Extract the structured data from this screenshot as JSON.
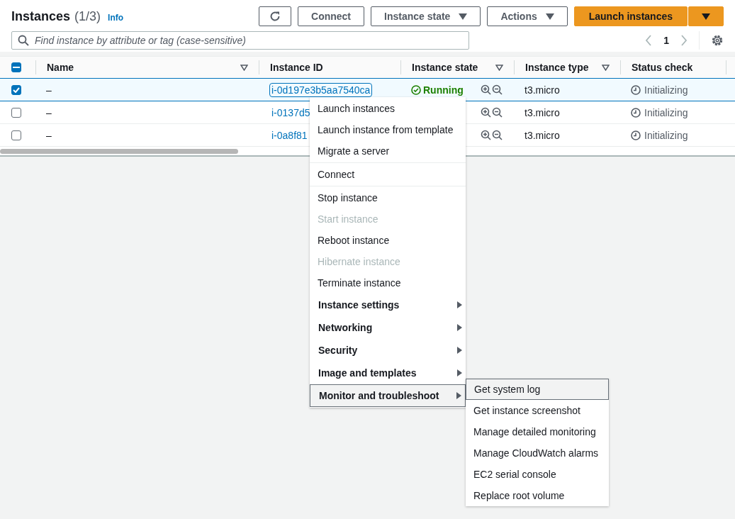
{
  "header": {
    "title": "Instances",
    "count": "(1/3)",
    "info": "Info"
  },
  "toolbar": {
    "buttons": [
      {
        "kind": "refresh"
      },
      {
        "kind": "plain",
        "label": "Connect"
      },
      {
        "kind": "dropdown",
        "label": "Instance state"
      },
      {
        "kind": "dropdown",
        "label": "Actions"
      },
      {
        "kind": "primary",
        "label": "Launch instances"
      }
    ]
  },
  "search": {
    "placeholder": "Find instance by attribute or tag (case-sensitive)"
  },
  "pagination": {
    "page": "1"
  },
  "table": {
    "select_all_partial": true,
    "columns": [
      {
        "label": "Name",
        "filter": true
      },
      {
        "label": "Instance ID",
        "filter": false
      },
      {
        "label": "Instance state",
        "filter": true
      },
      {
        "label": "Instance type",
        "filter": true
      },
      {
        "label": "Status check",
        "filter": false
      }
    ],
    "rows": [
      {
        "selected": true,
        "name": "–",
        "instance_id": "i-0d197e3b5aa7540ca",
        "state": "Running",
        "type": "t3.micro",
        "status": "Initializing"
      },
      {
        "selected": false,
        "name": "–",
        "instance_id": "i-0137d5",
        "type": "t3.micro",
        "status": "Initializing"
      },
      {
        "selected": false,
        "name": "–",
        "instance_id": "i-0a8f81",
        "type": "t3.micro",
        "status": "Initializing"
      }
    ]
  },
  "menu": {
    "sections": [
      [
        {
          "kind": "action",
          "label": "Launch instances",
          "disabled": false,
          "selected": false
        },
        {
          "kind": "action",
          "label": "Launch instance from template",
          "disabled": false,
          "selected": false
        },
        {
          "kind": "action",
          "label": "Migrate a server",
          "disabled": false,
          "selected": false
        }
      ],
      [
        {
          "kind": "action",
          "label": "Connect",
          "disabled": false,
          "selected": false
        }
      ],
      [
        {
          "kind": "action",
          "label": "Stop instance",
          "disabled": false,
          "selected": false
        },
        {
          "kind": "action",
          "label": "Start instance",
          "disabled": true,
          "selected": false
        },
        {
          "kind": "action",
          "label": "Reboot instance",
          "disabled": false,
          "selected": false
        },
        {
          "kind": "action",
          "label": "Hibernate instance",
          "disabled": true,
          "selected": false
        },
        {
          "kind": "action",
          "label": "Terminate instance",
          "disabled": false,
          "selected": false
        },
        {
          "kind": "submenu",
          "label": "Instance settings",
          "disabled": false,
          "selected": false
        },
        {
          "kind": "submenu",
          "label": "Networking",
          "disabled": false,
          "selected": false
        },
        {
          "kind": "submenu",
          "label": "Security",
          "disabled": false,
          "selected": false
        },
        {
          "kind": "submenu",
          "label": "Image and templates",
          "disabled": false,
          "selected": false
        },
        {
          "kind": "submenu",
          "label": "Monitor and troubleshoot",
          "disabled": false,
          "selected": true
        }
      ]
    ],
    "submenu": [
      {
        "label": "Get system log",
        "selected": true
      },
      {
        "label": "Get instance screenshot",
        "selected": false
      },
      {
        "label": "Manage detailed monitoring",
        "selected": false
      },
      {
        "label": "Manage CloudWatch alarms",
        "selected": false
      },
      {
        "label": "EC2 serial console",
        "selected": false
      },
      {
        "label": "Replace root volume",
        "selected": false
      }
    ]
  }
}
